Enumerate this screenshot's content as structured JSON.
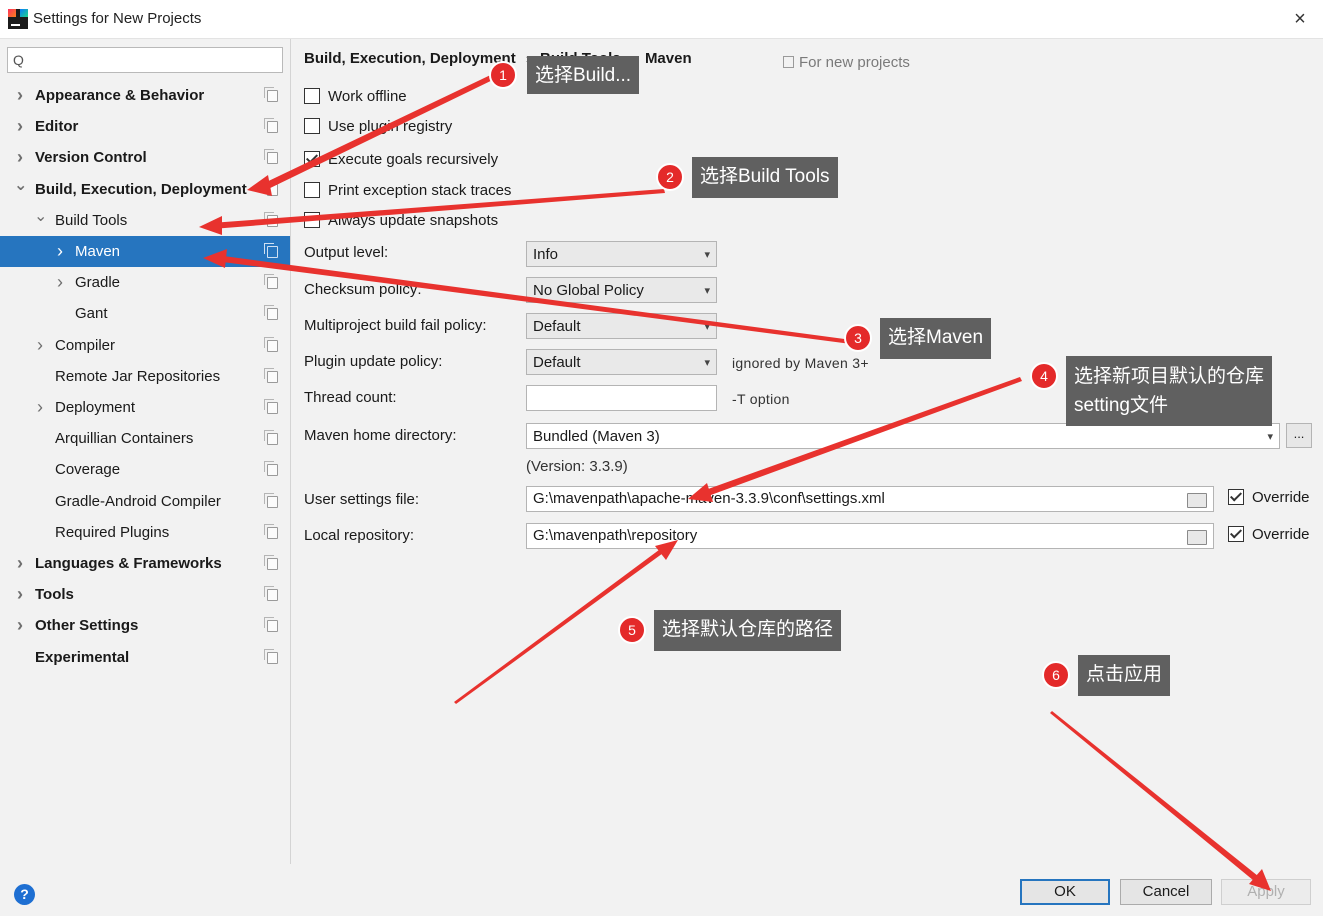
{
  "window": {
    "title": "Settings for New Projects",
    "close_icon": "×"
  },
  "search": {
    "placeholder": "",
    "icon": "Q"
  },
  "sidebar": {
    "items": [
      {
        "label": "Appearance & Behavior",
        "has_arrow": true,
        "expanded": false,
        "bold": true
      },
      {
        "label": "Editor",
        "has_arrow": true,
        "expanded": false,
        "bold": true
      },
      {
        "label": "Version Control",
        "has_arrow": true,
        "expanded": false,
        "bold": true
      },
      {
        "label": "Build, Execution, Deployment",
        "has_arrow": true,
        "expanded": true,
        "bold": true
      },
      {
        "label": "Build Tools",
        "has_arrow": true,
        "expanded": true,
        "bold": false
      },
      {
        "label": "Maven",
        "has_arrow": true,
        "expanded": false,
        "bold": false,
        "selected": true
      },
      {
        "label": "Gradle",
        "has_arrow": true,
        "expanded": false,
        "bold": false
      },
      {
        "label": "Gant",
        "has_arrow": false,
        "bold": false
      },
      {
        "label": "Compiler",
        "has_arrow": true,
        "expanded": false,
        "bold": false
      },
      {
        "label": "Remote Jar Repositories",
        "has_arrow": false,
        "bold": false
      },
      {
        "label": "Deployment",
        "has_arrow": true,
        "expanded": false,
        "bold": false
      },
      {
        "label": "Arquillian Containers",
        "has_arrow": false,
        "bold": false
      },
      {
        "label": "Coverage",
        "has_arrow": false,
        "bold": false
      },
      {
        "label": "Gradle-Android Compiler",
        "has_arrow": false,
        "bold": false
      },
      {
        "label": "Required Plugins",
        "has_arrow": false,
        "bold": false
      },
      {
        "label": "Languages & Frameworks",
        "has_arrow": true,
        "expanded": false,
        "bold": true
      },
      {
        "label": "Tools",
        "has_arrow": true,
        "expanded": false,
        "bold": true
      },
      {
        "label": "Other Settings",
        "has_arrow": true,
        "expanded": false,
        "bold": true
      },
      {
        "label": "Experimental",
        "has_arrow": false,
        "bold": true
      }
    ]
  },
  "breadcrumb": {
    "parts": [
      "Build, Execution, Deployment",
      "Build Tools",
      "Maven"
    ],
    "sep": "›",
    "scope": "For new projects"
  },
  "options": {
    "work_offline": {
      "label": "Work offline",
      "checked": false
    },
    "use_plugin_registry": {
      "label": "Use plugin registry",
      "checked": false
    },
    "execute_goals_recursively": {
      "label": "Execute goals recursively",
      "checked": true
    },
    "print_exception_stack_traces": {
      "label": "Print exception stack traces",
      "checked": false
    },
    "always_update_snapshots": {
      "label": "Always update snapshots",
      "checked": false
    }
  },
  "form": {
    "output_level": {
      "label": "Output level:",
      "value": "Info"
    },
    "checksum_policy": {
      "label": "Checksum policy:",
      "value": "No Global Policy"
    },
    "multiproject_fail_policy": {
      "label": "Multiproject build fail policy:",
      "value": "Default"
    },
    "plugin_update_policy": {
      "label": "Plugin update policy:",
      "value": "Default",
      "hint": "ignored by Maven 3+"
    },
    "thread_count": {
      "label": "Thread count:",
      "value": "",
      "hint": "-T option"
    },
    "maven_home": {
      "label": "Maven home directory:",
      "value": "Bundled (Maven 3)",
      "browse": "...",
      "version": "(Version: 3.3.9)"
    },
    "user_settings": {
      "label": "User settings file:",
      "value": "G:\\mavenpath\\apache-maven-3.3.9\\conf\\settings.xml",
      "override_label": "Override",
      "override_checked": true
    },
    "local_repository": {
      "label": "Local repository:",
      "value": "G:\\mavenpath\\repository",
      "override_label": "Override",
      "override_checked": true
    }
  },
  "footer": {
    "help": "?",
    "ok": "OK",
    "cancel": "Cancel",
    "apply": "Apply"
  },
  "annotations": [
    {
      "num": "1",
      "text": "选择Build..."
    },
    {
      "num": "2",
      "text": "选择Build Tools"
    },
    {
      "num": "3",
      "text": "选择Maven"
    },
    {
      "num": "4",
      "text": "选择新项目默认的仓库",
      "text2": "setting文件"
    },
    {
      "num": "5",
      "text": "选择默认仓库的路径"
    },
    {
      "num": "6",
      "text": "点击应用"
    }
  ],
  "colors": {
    "selection": "#2675bf",
    "annotation_bg": "#606060",
    "annotation_badge": "#e42a2a",
    "arrow": "#e8322e"
  }
}
